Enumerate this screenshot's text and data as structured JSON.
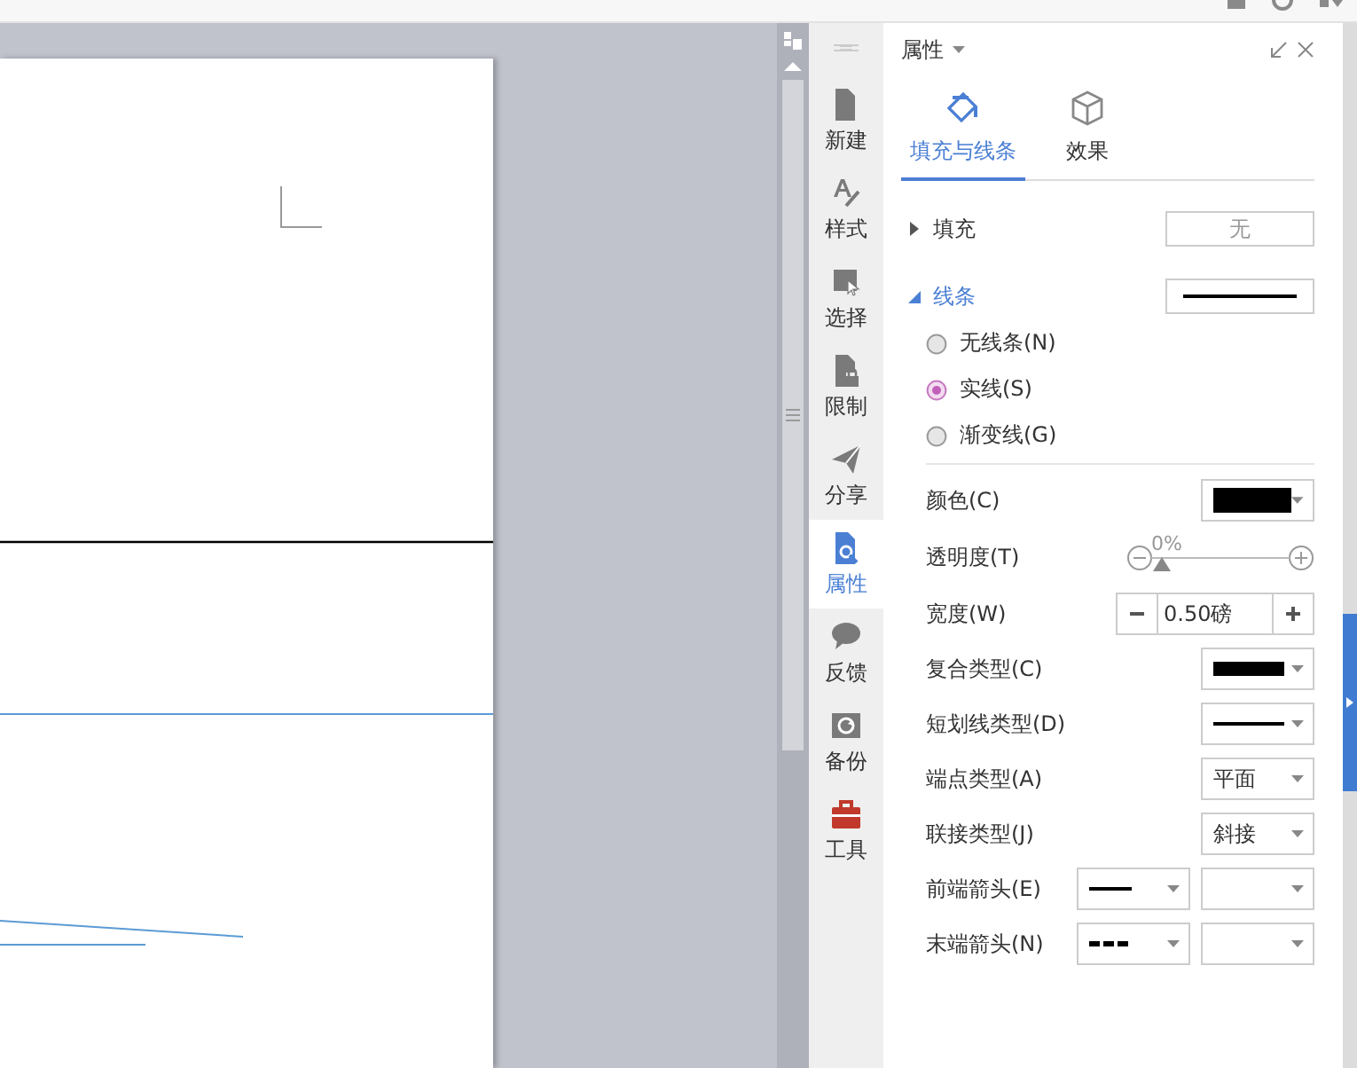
{
  "sidebar": {
    "items": [
      {
        "label": "新建",
        "selected": false
      },
      {
        "label": "样式",
        "selected": false
      },
      {
        "label": "选择",
        "selected": false
      },
      {
        "label": "限制",
        "selected": false
      },
      {
        "label": "分享",
        "selected": false
      },
      {
        "label": "属性",
        "selected": true
      },
      {
        "label": "反馈",
        "selected": false
      },
      {
        "label": "备份",
        "selected": false
      },
      {
        "label": "工具",
        "selected": false
      }
    ]
  },
  "panel": {
    "title": "属性",
    "tabs": [
      {
        "label": "填充与线条",
        "selected": true
      },
      {
        "label": "效果",
        "selected": false
      }
    ],
    "sections": [
      {
        "kind": "text",
        "label": "填充",
        "expanded": false,
        "value": "无"
      },
      {
        "kind": "line",
        "label": "线条",
        "expanded": true
      }
    ],
    "line_options": [
      {
        "label": "无线条(N)",
        "selected": false
      },
      {
        "label": "实线(S)",
        "selected": true
      },
      {
        "label": "渐变线(G)",
        "selected": false
      }
    ],
    "properties": [
      {
        "kind": "color",
        "label": "颜色(C)"
      },
      {
        "kind": "slider",
        "label": "透明度(T)",
        "reading": "0%",
        "level": 0
      },
      {
        "kind": "stepper",
        "label": "宽度(W)",
        "value": "0.50磅"
      },
      {
        "kind": "compound",
        "label": "复合类型(C)"
      },
      {
        "kind": "dash",
        "label": "短划线类型(D)"
      },
      {
        "kind": "select",
        "label": "端点类型(A)",
        "value": "平面"
      },
      {
        "kind": "select",
        "label": "联接类型(J)",
        "value": "斜接"
      },
      {
        "kind": "arrow_solid",
        "label": "前端箭头(E)"
      },
      {
        "kind": "arrow_dashed",
        "label": "末端箭头(N)"
      }
    ]
  }
}
